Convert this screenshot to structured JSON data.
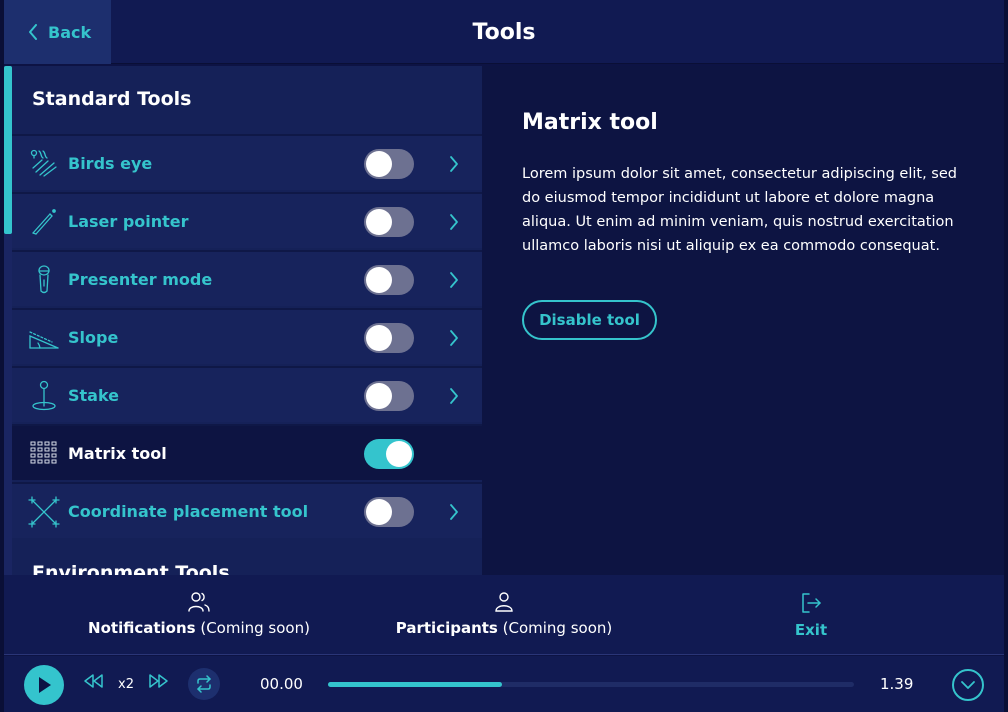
{
  "header": {
    "back_label": "Back",
    "title": "Tools"
  },
  "sections": {
    "standard_title": "Standard Tools",
    "environment_title": "Environment Tools"
  },
  "tools": [
    {
      "label": "Birds eye",
      "icon": "birds-eye-icon",
      "enabled": false,
      "active": false
    },
    {
      "label": "Laser pointer",
      "icon": "laser-pointer-icon",
      "enabled": false,
      "active": false
    },
    {
      "label": "Presenter mode",
      "icon": "microphone-icon",
      "enabled": false,
      "active": false
    },
    {
      "label": "Slope",
      "icon": "slope-icon",
      "enabled": false,
      "active": false
    },
    {
      "label": "Stake",
      "icon": "stake-icon",
      "enabled": false,
      "active": false
    },
    {
      "label": "Matrix tool",
      "icon": "matrix-grid-icon",
      "enabled": true,
      "active": true
    },
    {
      "label": "Coordinate placement tool",
      "icon": "coordinate-placement-icon",
      "enabled": false,
      "active": false
    }
  ],
  "detail": {
    "title": "Matrix tool",
    "description": "Lorem ipsum dolor sit amet, consectetur adipiscing elit, sed do eiusmod tempor incididunt ut labore et dolore magna aliqua. Ut enim ad minim veniam, quis nostrud exercitation ullamco laboris nisi ut aliquip ex ea commodo consequat.",
    "button_label": "Disable tool"
  },
  "bottom_nav": {
    "notifications": {
      "label": "Notifications",
      "suffix": " (Coming soon)"
    },
    "participants": {
      "label": "Participants",
      "suffix": " (Coming soon)"
    },
    "exit": {
      "label": "Exit"
    }
  },
  "playback": {
    "speed": "x2",
    "time_start": "00.00",
    "time_end": "1.39",
    "progress": 0.33
  },
  "colors": {
    "accent": "#34c4cd",
    "background": "#0d1344",
    "panel": "#152158"
  }
}
